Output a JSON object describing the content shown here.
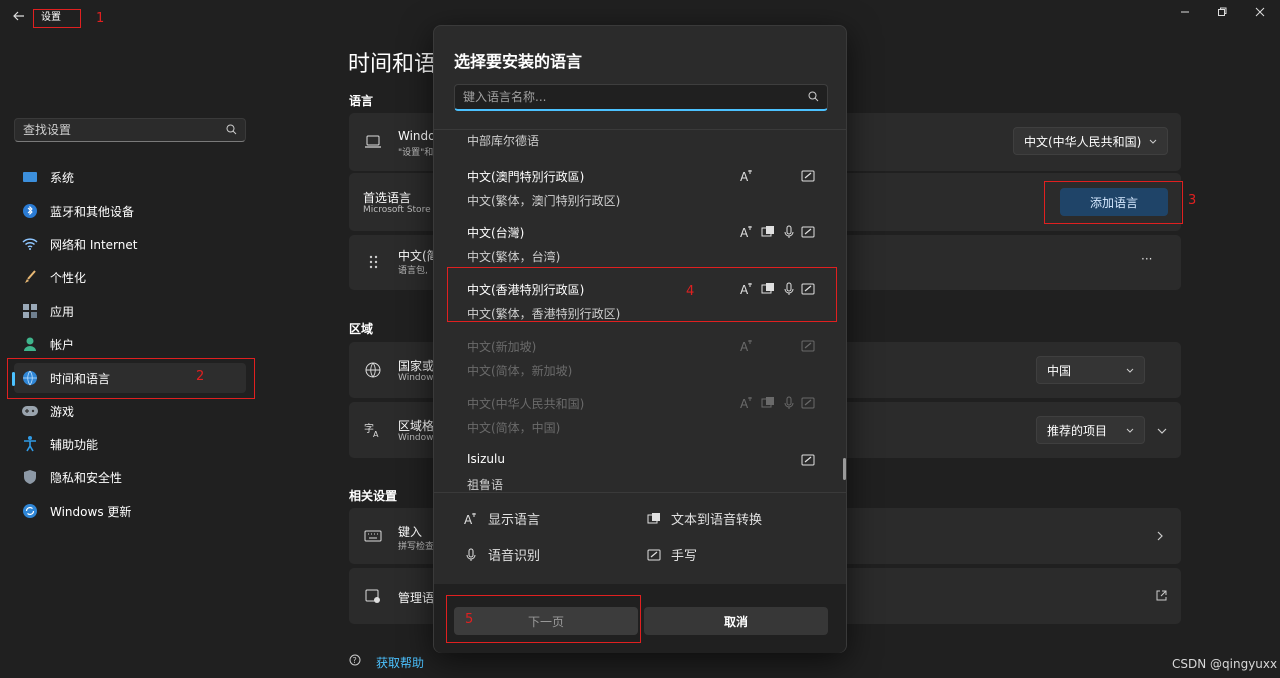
{
  "titlebar": {
    "app_title": "设置",
    "annotation": "1"
  },
  "sidebar": {
    "search_placeholder": "查找设置",
    "items": [
      {
        "label": "系统",
        "icon": "monitor-icon"
      },
      {
        "label": "蓝牙和其他设备",
        "icon": "bluetooth-icon"
      },
      {
        "label": "网络和 Internet",
        "icon": "wifi-icon"
      },
      {
        "label": "个性化",
        "icon": "brush-icon"
      },
      {
        "label": "应用",
        "icon": "apps-icon"
      },
      {
        "label": "帐户",
        "icon": "person-icon"
      },
      {
        "label": "时间和语言",
        "icon": "globe-clock-icon"
      },
      {
        "label": "游戏",
        "icon": "gamepad-icon"
      },
      {
        "label": "辅助功能",
        "icon": "accessibility-icon"
      },
      {
        "label": "隐私和安全性",
        "icon": "shield-icon"
      },
      {
        "label": "Windows 更新",
        "icon": "update-icon"
      }
    ],
    "active_annotation": "2"
  },
  "main": {
    "page_title": "时间和语",
    "section_language": "语言",
    "display_language_title": "Windo",
    "display_language_sub": "\"设置\"和",
    "display_language_value": "中文(中华人民共和国)",
    "preferred_title": "首选语言",
    "preferred_sub": "Microsoft Store",
    "add_language_label": "添加语言",
    "add_language_annotation": "3",
    "installed_lang_title": "中文(简",
    "installed_lang_sub": "语言包,",
    "more_label": "···",
    "section_region": "区域",
    "country_title": "国家或",
    "country_sub": "Window",
    "country_value": "中国",
    "format_title": "区域格",
    "format_sub": "Window",
    "format_value": "推荐的项目",
    "section_related": "相关设置",
    "keyboard_title": "键入",
    "keyboard_sub": "拼写检查",
    "manage_title": "管理语",
    "help_label": "获取帮助"
  },
  "dialog": {
    "title": "选择要安装的语言",
    "search_placeholder": "键入语言名称...",
    "partial_item": "中部库尔德语",
    "languages": [
      {
        "name": "中文(澳門特別行政區)",
        "sub": "中文(繁体，澳门特别行政区)",
        "features": [
          "display",
          "handwriting"
        ],
        "disabled": false
      },
      {
        "name": "中文(台灣)",
        "sub": "中文(繁体，台湾)",
        "features": [
          "display",
          "tts",
          "speech",
          "handwriting"
        ],
        "disabled": false
      },
      {
        "name": "中文(香港特別行政區)",
        "sub": "中文(繁体，香港特别行政区)",
        "features": [
          "display",
          "tts",
          "speech",
          "handwriting"
        ],
        "disabled": false
      },
      {
        "name": "中文(新加坡)",
        "sub": "中文(简体，新加坡)",
        "features": [
          "display",
          "handwriting"
        ],
        "disabled": true
      },
      {
        "name": "中文(中华人民共和国)",
        "sub": "中文(简体，中国)",
        "features": [
          "display",
          "tts",
          "speech",
          "handwriting"
        ],
        "disabled": true
      },
      {
        "name": "Isizulu",
        "sub": "祖鲁语",
        "features": [
          "handwriting"
        ],
        "disabled": false
      }
    ],
    "selected_annotation": "4",
    "legend": {
      "display": "显示语言",
      "tts": "文本到语音转换",
      "speech": "语音识别",
      "handwriting": "手写"
    },
    "next_label": "下一页",
    "next_annotation": "5",
    "cancel_label": "取消"
  },
  "watermark": "CSDN @qingyuxx",
  "colors": {
    "accent": "#4cc2ff",
    "annotation": "#e02020",
    "background": "#202020",
    "card": "#2b2b2b"
  }
}
